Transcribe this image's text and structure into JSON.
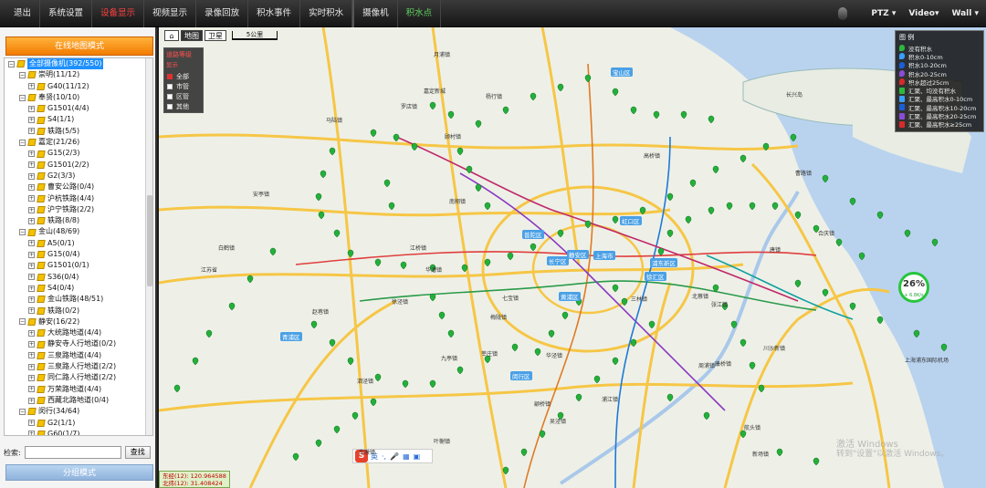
{
  "menu": {
    "items": [
      {
        "label": "退出",
        "style": "normal"
      },
      {
        "label": "系统设置",
        "style": "normal"
      },
      {
        "label": "设备显示",
        "style": "red"
      },
      {
        "label": "视频显示",
        "style": "normal"
      },
      {
        "label": "录像回放",
        "style": "normal"
      },
      {
        "label": "积水事件",
        "style": "normal"
      },
      {
        "label": "实时积水",
        "style": "normal"
      },
      {
        "label": "摄像机",
        "style": "sep"
      },
      {
        "label": "积水点",
        "style": "green"
      }
    ],
    "ptz": "PTZ ▾",
    "video": "Video▾",
    "wall": "Wall ▾"
  },
  "left": {
    "map_mode_button": "在线地图模式",
    "tree": [
      {
        "level": 0,
        "label": "全部摄像机(392/550)",
        "selected": true,
        "expander": "−"
      },
      {
        "level": 1,
        "label": "崇明(11/12)",
        "expander": "−"
      },
      {
        "level": 2,
        "label": "G40(11/12)",
        "expander": "+"
      },
      {
        "level": 1,
        "label": "奉贤(10/10)",
        "expander": "−"
      },
      {
        "level": 2,
        "label": "G1501(4/4)",
        "expander": "+"
      },
      {
        "level": 2,
        "label": "S4(1/1)",
        "expander": "+"
      },
      {
        "level": 2,
        "label": "轶路(5/5)",
        "expander": "+"
      },
      {
        "level": 1,
        "label": "嘉定(21/26)",
        "expander": "−"
      },
      {
        "level": 2,
        "label": "G15(2/3)",
        "expander": "+"
      },
      {
        "level": 2,
        "label": "G1501(2/2)",
        "expander": "+"
      },
      {
        "level": 2,
        "label": "G2(3/3)",
        "expander": "+"
      },
      {
        "level": 2,
        "label": "曹安公路(0/4)",
        "expander": "+"
      },
      {
        "level": 2,
        "label": "沪杭铁路(4/4)",
        "expander": "+"
      },
      {
        "level": 2,
        "label": "沪宁铁路(2/2)",
        "expander": "+"
      },
      {
        "level": 2,
        "label": "轶路(8/8)",
        "expander": "+"
      },
      {
        "level": 1,
        "label": "金山(48/69)",
        "expander": "−"
      },
      {
        "level": 2,
        "label": "A5(0/1)",
        "expander": "+"
      },
      {
        "level": 2,
        "label": "G15(0/4)",
        "expander": "+"
      },
      {
        "level": 2,
        "label": "G1501(0/1)",
        "expander": "+"
      },
      {
        "level": 2,
        "label": "S36(0/4)",
        "expander": "+"
      },
      {
        "level": 2,
        "label": "S4(0/4)",
        "expander": "+"
      },
      {
        "level": 2,
        "label": "金山铁路(48/51)",
        "expander": "+"
      },
      {
        "level": 2,
        "label": "轶路(0/2)",
        "expander": "+"
      },
      {
        "level": 1,
        "label": "静安(16/22)",
        "expander": "−"
      },
      {
        "level": 2,
        "label": "大统路地道(4/4)",
        "expander": "+"
      },
      {
        "level": 2,
        "label": "静安寺人行地道(0/2)",
        "expander": "+"
      },
      {
        "level": 2,
        "label": "三泉路地道(4/4)",
        "expander": "+"
      },
      {
        "level": 2,
        "label": "三泉路人行地道(2/2)",
        "expander": "+"
      },
      {
        "level": 2,
        "label": "同仁路人行地道(2/2)",
        "expander": "+"
      },
      {
        "level": 2,
        "label": "万荣路地道(4/4)",
        "expander": "+"
      },
      {
        "level": 2,
        "label": "西藏北路地道(0/4)",
        "expander": "+"
      },
      {
        "level": 1,
        "label": "闵行(34/64)",
        "expander": "−"
      },
      {
        "level": 2,
        "label": "G2(1/1)",
        "expander": "+"
      },
      {
        "level": 2,
        "label": "G60(1/7)",
        "expander": "+"
      }
    ],
    "search_label": "检索:",
    "search_value": "",
    "search_button": "查找",
    "group_mode_button": "分组模式"
  },
  "map": {
    "home": "⌂",
    "tab_map": "地图",
    "tab_sat": "卫星",
    "scale": "5公里",
    "filter": {
      "title": "道路等级",
      "subtitle": "显示",
      "options": [
        {
          "label": "全部",
          "checked": true
        },
        {
          "label": "市管",
          "checked": false
        },
        {
          "label": "区管",
          "checked": false
        },
        {
          "label": "其他",
          "checked": false
        }
      ]
    },
    "legend": {
      "title": "图 例",
      "items": [
        {
          "label": "没有积水",
          "color": "#2db83d"
        },
        {
          "label": "积水0-10cm",
          "color": "#3aa0ff"
        },
        {
          "label": "积水10-20cm",
          "color": "#1a5fd8"
        },
        {
          "label": "积水20-25cm",
          "color": "#8a4bd8"
        },
        {
          "label": "积水超过25cm",
          "color": "#d82a2a"
        },
        {
          "label": "汇聚、均没有积水",
          "color": "#2db83d"
        },
        {
          "label": "汇聚、最高积水0-10cm",
          "color": "#3aa0ff"
        },
        {
          "label": "汇聚、最高积水10-20cm",
          "color": "#1a5fd8"
        },
        {
          "label": "汇聚、最高积水20-25cm",
          "color": "#8a4bd8"
        },
        {
          "label": "汇聚、最高积水≥25cm",
          "color": "#d82a2a"
        }
      ]
    },
    "gauge": {
      "percent": "26%",
      "sub": "+ 6.8K/s"
    },
    "ime": {
      "s": "S",
      "items": [
        "英",
        "·,",
        "🎤",
        "▦",
        "▣"
      ]
    },
    "coords": {
      "lng_label": "东经(12):",
      "lng": "120.964588",
      "lat_label": "北纬(12):",
      "lat": "31.408424"
    },
    "watermark": {
      "line1": "激活 Windows",
      "line2": "转到\"设置\"以激活 Windows。"
    },
    "district_labels": [
      {
        "text": "宝山区"
      },
      {
        "text": "长宁区"
      },
      {
        "text": "虹口区"
      },
      {
        "text": "普陀区"
      },
      {
        "text": "静安区"
      },
      {
        "text": "黄浦区"
      },
      {
        "text": "徐汇区"
      },
      {
        "text": "浦东新区"
      },
      {
        "text": "闵行区"
      },
      {
        "text": "青浦区"
      },
      {
        "text": "上海市"
      }
    ],
    "place_labels": [
      {
        "text": "嘉定新城"
      },
      {
        "text": "南翔镇"
      },
      {
        "text": "安亭镇"
      },
      {
        "text": "江桥镇"
      },
      {
        "text": "华漕镇"
      },
      {
        "text": "徐泾镇"
      },
      {
        "text": "赵巷镇"
      },
      {
        "text": "白鹤镇"
      },
      {
        "text": "九亭镇"
      },
      {
        "text": "七宝镇"
      },
      {
        "text": "莘庄镇"
      },
      {
        "text": "泗泾镇"
      },
      {
        "text": "颛桥镇"
      },
      {
        "text": "梅陇镇"
      },
      {
        "text": "张江镇"
      },
      {
        "text": "北蔡镇"
      },
      {
        "text": "川沙新镇"
      },
      {
        "text": "高桥镇"
      },
      {
        "text": "罗店镇"
      },
      {
        "text": "月浦镇"
      },
      {
        "text": "杨行镇"
      },
      {
        "text": "顾村镇"
      },
      {
        "text": "马陆镇"
      },
      {
        "text": "浦江镇"
      },
      {
        "text": "航头镇"
      },
      {
        "text": "新场镇"
      },
      {
        "text": "康桥镇"
      },
      {
        "text": "周浦镇"
      },
      {
        "text": "上海浦东国际机场"
      },
      {
        "text": "江苏省"
      },
      {
        "text": "长兴岛"
      },
      {
        "text": "横沙乡"
      },
      {
        "text": "曹路镇"
      },
      {
        "text": "合庆镇"
      },
      {
        "text": "唐镇"
      },
      {
        "text": "三林镇"
      },
      {
        "text": "华泾镇"
      },
      {
        "text": "吴泾镇"
      },
      {
        "text": "车墩镇"
      },
      {
        "text": "叶榭镇"
      }
    ]
  }
}
